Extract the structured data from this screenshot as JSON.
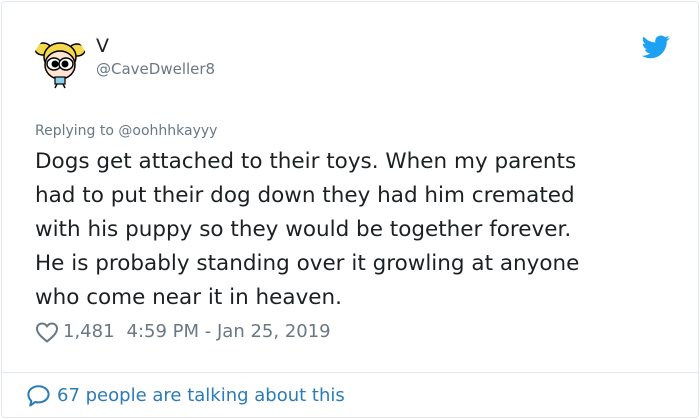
{
  "tweet": {
    "author": {
      "display_name": "V",
      "handle": "@CaveDweller8",
      "avatar": "powerpuff-girl-avatar"
    },
    "reply_to": "Replying to @oohhhkayyy",
    "text": "Dogs get attached to their toys.  When my parents\nhad to put their dog down they had him cremated\nwith his puppy so they would be together forever.\nHe is probably standing over it growling at anyone\nwho come near it in heaven.",
    "likes": "1,481",
    "timestamp": "4:59 PM - Jan 25, 2019",
    "conversation": "67 people are talking about this"
  },
  "icons": {
    "brand": "twitter-bird-icon",
    "like": "heart-icon",
    "conversation": "speech-bubble-icon"
  },
  "colors": {
    "brand_blue": "#1da1f2",
    "link_blue": "#2b7bb9",
    "muted_text": "#697882",
    "primary_text": "#1c2022",
    "border": "#e1e8ed"
  }
}
